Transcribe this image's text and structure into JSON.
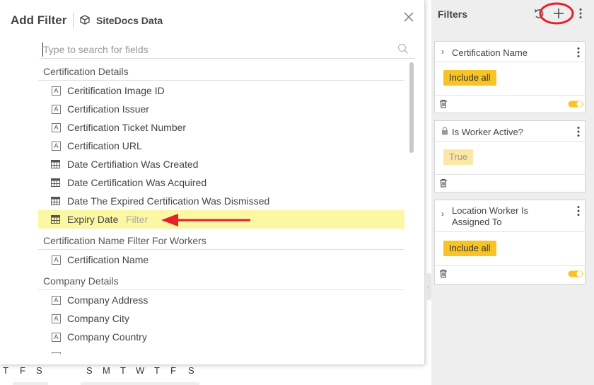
{
  "modal": {
    "title": "Add Filter",
    "datasource": "SiteDocs Data",
    "search_placeholder": "Type to search for fields",
    "filter_hint": "Filter",
    "groups": [
      {
        "name": "Certification Details",
        "fields": [
          {
            "label": "Ceritification Image ID",
            "type": "text"
          },
          {
            "label": "Certification Issuer",
            "type": "text"
          },
          {
            "label": "Certification Ticket Number",
            "type": "text"
          },
          {
            "label": "Certification URL",
            "type": "text"
          },
          {
            "label": "Date Certifiation Was Created",
            "type": "date"
          },
          {
            "label": "Date Certification Was Acquired",
            "type": "date"
          },
          {
            "label": "Date The Expired Certification Was Dismissed",
            "type": "date"
          },
          {
            "label": "Expiry Date",
            "type": "date",
            "highlighted": true
          }
        ]
      },
      {
        "name": "Certification Name Filter For Workers",
        "fields": [
          {
            "label": "Certification Name",
            "type": "text"
          }
        ]
      },
      {
        "name": "Company Details",
        "fields": [
          {
            "label": "Company Address",
            "type": "text"
          },
          {
            "label": "Company City",
            "type": "text"
          },
          {
            "label": "Company Country",
            "type": "text"
          }
        ]
      }
    ]
  },
  "panel": {
    "title": "Filters",
    "cards": [
      {
        "title": "Certification Name",
        "chip": "Include all",
        "chip_state": "active",
        "locked": false,
        "toggle_on": true
      },
      {
        "title": "Is Worker Active?",
        "chip": "True",
        "chip_state": "disabled",
        "locked": true,
        "toggle_on": false
      },
      {
        "title": "Location Worker Is Assigned To",
        "chip": "Include all",
        "chip_state": "active",
        "locked": false,
        "toggle_on": true
      }
    ]
  },
  "calendar": {
    "days_left": [
      "T",
      "F",
      "S"
    ],
    "days_right": [
      "S",
      "M",
      "T",
      "W",
      "T",
      "F",
      "S"
    ]
  },
  "colors": {
    "highlight_row": "#fbf7a2",
    "chip_active": "#f7c325",
    "annotation_red": "#e8202a"
  },
  "icons": {
    "text_field": "A",
    "date_field": "calendar-table-icon",
    "close": "close-icon",
    "search": "search-icon",
    "add": "plus-icon",
    "undo": "undo-icon"
  }
}
